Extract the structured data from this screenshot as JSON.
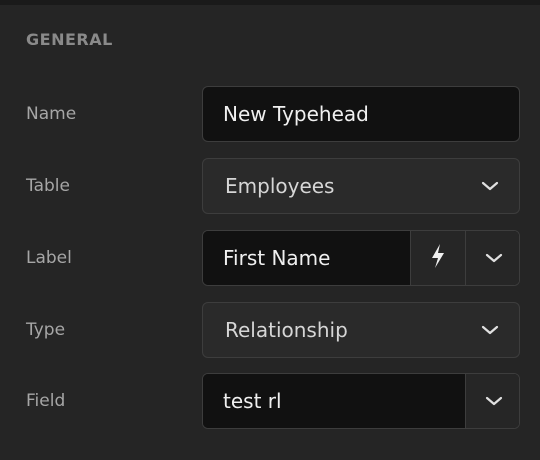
{
  "section": {
    "title": "GENERAL"
  },
  "rows": [
    {
      "label": "Name",
      "value": "New Typehead",
      "kind": "text-input"
    },
    {
      "label": "Table",
      "value": "Employees",
      "kind": "select"
    },
    {
      "label": "Label",
      "value": "First Name",
      "kind": "input-with-action-and-dropdown",
      "action_icon": "lightning-bolt-icon"
    },
    {
      "label": "Type",
      "value": "Relationship",
      "kind": "select"
    },
    {
      "label": "Field",
      "value": "test rl",
      "kind": "input-with-dropdown"
    }
  ],
  "icons": {
    "dropdown": "chevron-down-icon",
    "dynamic": "lightning-bolt-icon"
  },
  "colors": {
    "background": "#252525",
    "input_bg": "#111111",
    "select_bg": "#2a2a2a",
    "border": "#3d3d3d",
    "label": "#a6a6a6",
    "section_header": "#8a8a8a",
    "value_text": "#f0f0f0"
  }
}
